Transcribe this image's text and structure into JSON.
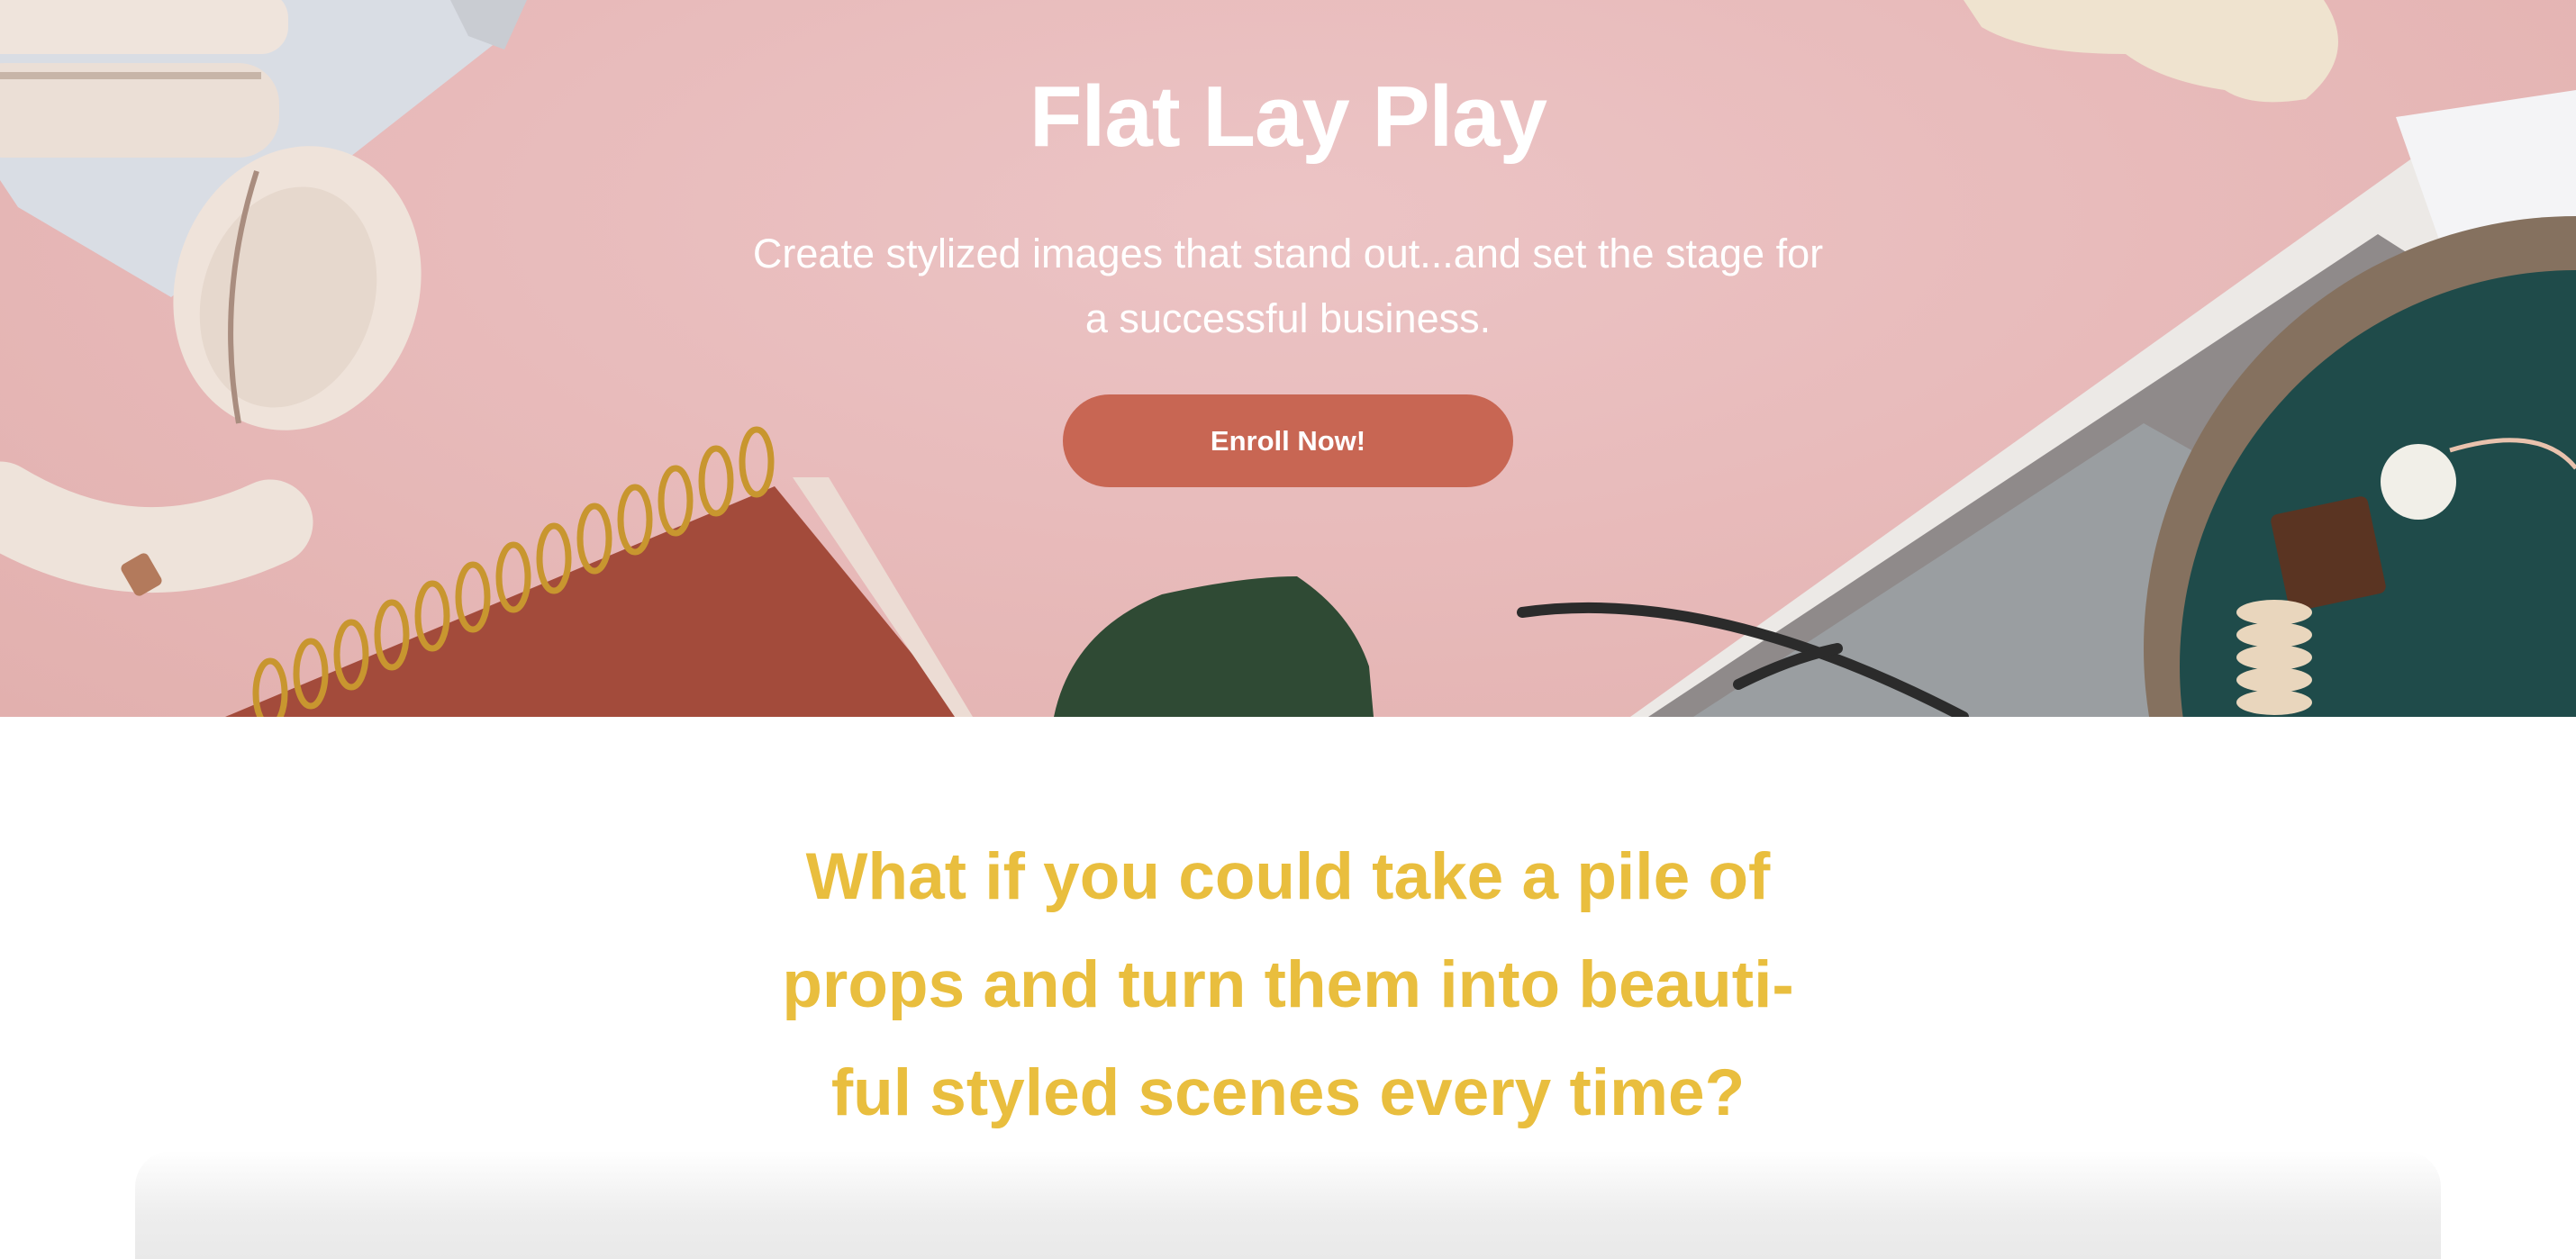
{
  "hero": {
    "title": "Flat Lay Play",
    "subtitle_line1": "Create stylized images that stand out...and set the stage for",
    "subtitle_line2": "a successful business.",
    "cta_label": "Enroll Now!",
    "background_color": "#e8bbbb",
    "cta_color": "#c86653",
    "decor": [
      "headphones",
      "spiral-notebook",
      "green-fabric",
      "eyeglasses",
      "magazine",
      "ceramic-bowl",
      "crumpled-paper"
    ]
  },
  "intro": {
    "heading_line1": "What if you could take a pile of",
    "heading_line2": "props and turn them into beauti-",
    "heading_line3": "ful styled scenes every time?",
    "heading_color": "#e9be3e"
  }
}
